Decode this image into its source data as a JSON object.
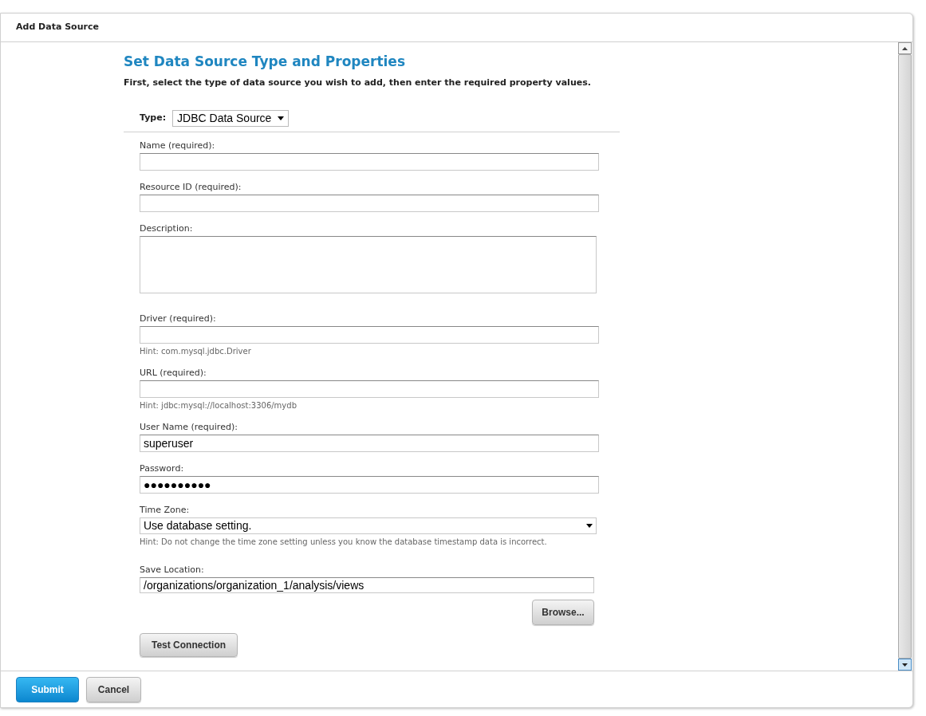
{
  "dialog": {
    "title": "Add Data Source"
  },
  "heading": "Set Data Source Type and Properties",
  "instructions": "First, select the type of data source you wish to add, then enter the required property values.",
  "type_field": {
    "label": "Type:",
    "value": "JDBC Data Source"
  },
  "fields": [
    {
      "kind": "text",
      "label": "Name (required):"
    },
    {
      "kind": "text",
      "label": "Resource ID (required):"
    },
    {
      "kind": "textarea",
      "label": "Description:"
    },
    {
      "kind": "text",
      "label": "Driver (required):",
      "hint": "Hint: com.mysql.jdbc.Driver"
    },
    {
      "kind": "text",
      "label": "URL (required):",
      "hint": "Hint: jdbc:mysql://localhost:3306/mydb"
    },
    {
      "kind": "text",
      "label": "User Name (required):",
      "value": "superuser"
    },
    {
      "kind": "text",
      "label": "Password:",
      "value": "●●●●●●●●●●"
    },
    {
      "kind": "select",
      "label": "Time Zone:",
      "value": "Use database setting.",
      "hint": "Hint: Do not change the time zone setting unless you know the database timestamp data is incorrect."
    },
    {
      "kind": "text",
      "label": "Save Location:",
      "value": "/organizations/organization_1/analysis/views"
    }
  ],
  "browse_button": "Browse...",
  "test_button": "Test Connection",
  "footer_buttons": [
    {
      "label": "Submit",
      "kind": "primary"
    },
    {
      "label": "Cancel",
      "kind": "secondary"
    }
  ]
}
